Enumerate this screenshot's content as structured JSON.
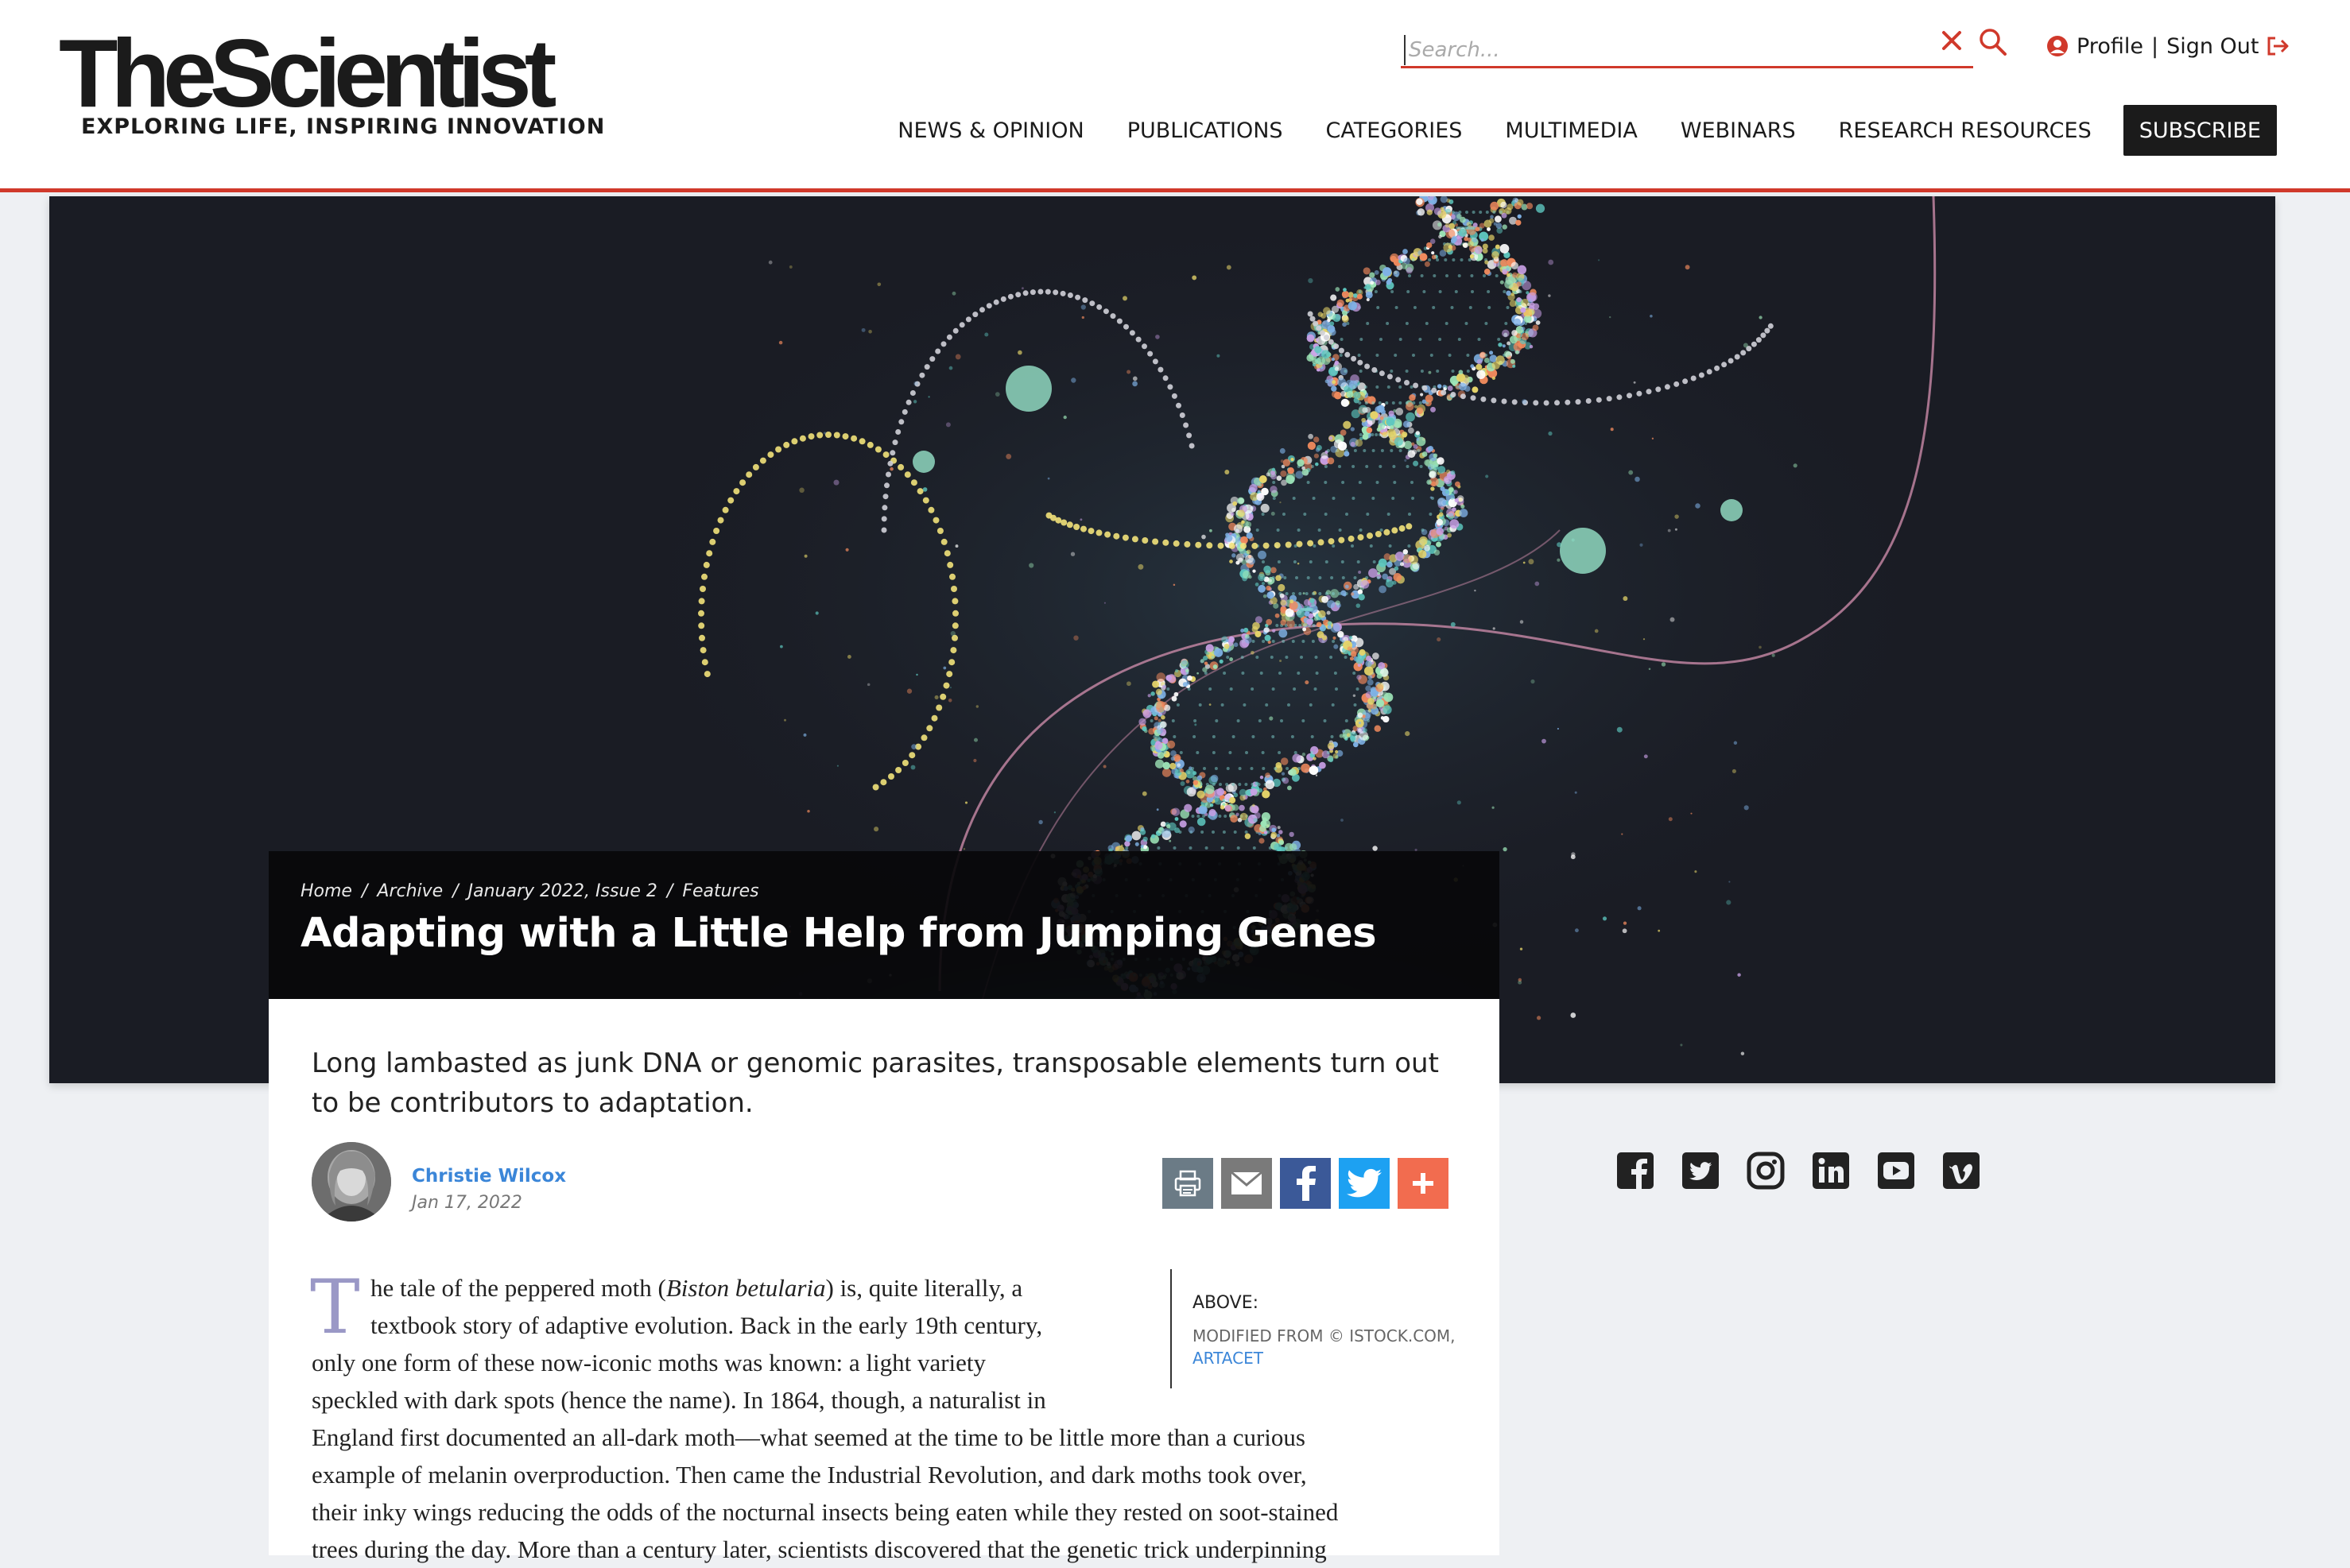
{
  "site": {
    "logo_text": "TheScientist",
    "tagline": "EXPLORING LIFE, INSPIRING INNOVATION"
  },
  "search": {
    "placeholder": "Search...",
    "value": ""
  },
  "account": {
    "profile": "Profile",
    "separator": "|",
    "sign_out": "Sign Out"
  },
  "nav": {
    "items": [
      "NEWS & OPINION",
      "PUBLICATIONS",
      "CATEGORIES",
      "MULTIMEDIA",
      "WEBINARS",
      "RESEARCH RESOURCES"
    ],
    "subscribe": "SUBSCRIBE"
  },
  "breadcrumb": [
    "Home",
    "Archive",
    "January 2022, Issue 2",
    "Features"
  ],
  "breadcrumb_separator": "/",
  "article": {
    "title": "Adapting with a Little Help from Jumping Genes",
    "dek": "Long lambasted as junk DNA or genomic parasites, transposable elements turn out to be contributors to adaptation.",
    "author": "Christie Wilcox",
    "date": "Jan 17, 2022",
    "dropcap": "T",
    "body_lines": [
      "he tale of the peppered moth (<i>Biston betularia</i>) is, quite literally, a",
      "textbook story of adaptive evolution. Back in the early 19th century,",
      "only one form of these now-iconic moths was known: a light variety",
      "speckled with dark spots (hence the name). In 1864, though, a naturalist in",
      "England first documented an all-dark moth—what seemed at the time to be little more than a curious",
      "example of melanin overproduction. Then came the Industrial Revolution, and dark moths took over,",
      "their inky wings reducing the odds of the nocturnal insects being eaten while they rested on soot-stained",
      "trees during the day. More than a century later, scientists discovered that the genetic trick underpinning"
    ]
  },
  "caption": {
    "label": "ABOVE:",
    "credit": "MODIFIED FROM © ISTOCK.COM,",
    "credit_link": "ARTACET"
  },
  "share_buttons": [
    "print-icon",
    "email-icon",
    "facebook-icon",
    "twitter-icon",
    "plus-icon"
  ],
  "social_icons": [
    "facebook-icon",
    "twitter-icon",
    "instagram-icon",
    "linkedin-icon",
    "youtube-icon",
    "vimeo-icon"
  ],
  "colors": {
    "accent_red": "#d0392b",
    "link_blue": "#3b86d8",
    "dropcap": "#9a98c6",
    "print": "#6b7b86",
    "email": "#7a7a7a",
    "facebook": "#3b5998",
    "twitter": "#1da1f2",
    "plus": "#f26c4f"
  }
}
